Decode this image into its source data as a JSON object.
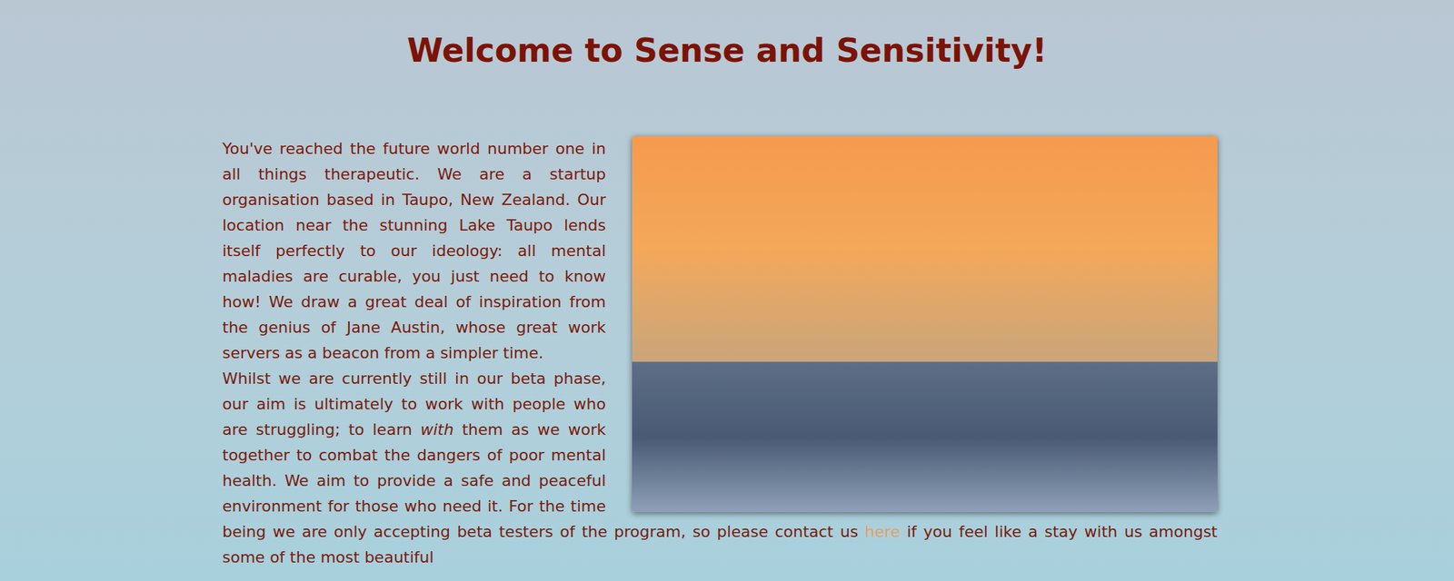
{
  "page": {
    "title": "Welcome to Sense and Sensitivity!"
  },
  "paragraphs": [
    {
      "segments": [
        {
          "kind": "plain",
          "text": "You've reached the future world number one in all things therapeutic. We are a startup organisation based in Taupo, New Zealand. Our location near the stunning Lake Taupo lends itself perfectly to our ideology: all mental maladies are curable, you just need to know how! We draw a great deal of inspiration from the genius of Jane Austin, whose great work servers as a beacon from a simpler time."
        }
      ]
    },
    {
      "segments": [
        {
          "kind": "plain",
          "text": "Whilst we are currently still in our beta phase, our aim is ultimately to work with people who are struggling; to learn "
        },
        {
          "kind": "italic",
          "text": "with"
        },
        {
          "kind": "plain",
          "text": " them as we work together to combat the dangers of poor mental health. We aim to provide a safe and peaceful environment for those who need it. For the time being we are only accepting beta testers of the program, so please contact us "
        },
        {
          "kind": "link",
          "text": "here"
        },
        {
          "kind": "plain",
          "text": " if you feel like a stay with us amongst some of the most beautiful"
        }
      ]
    }
  ]
}
